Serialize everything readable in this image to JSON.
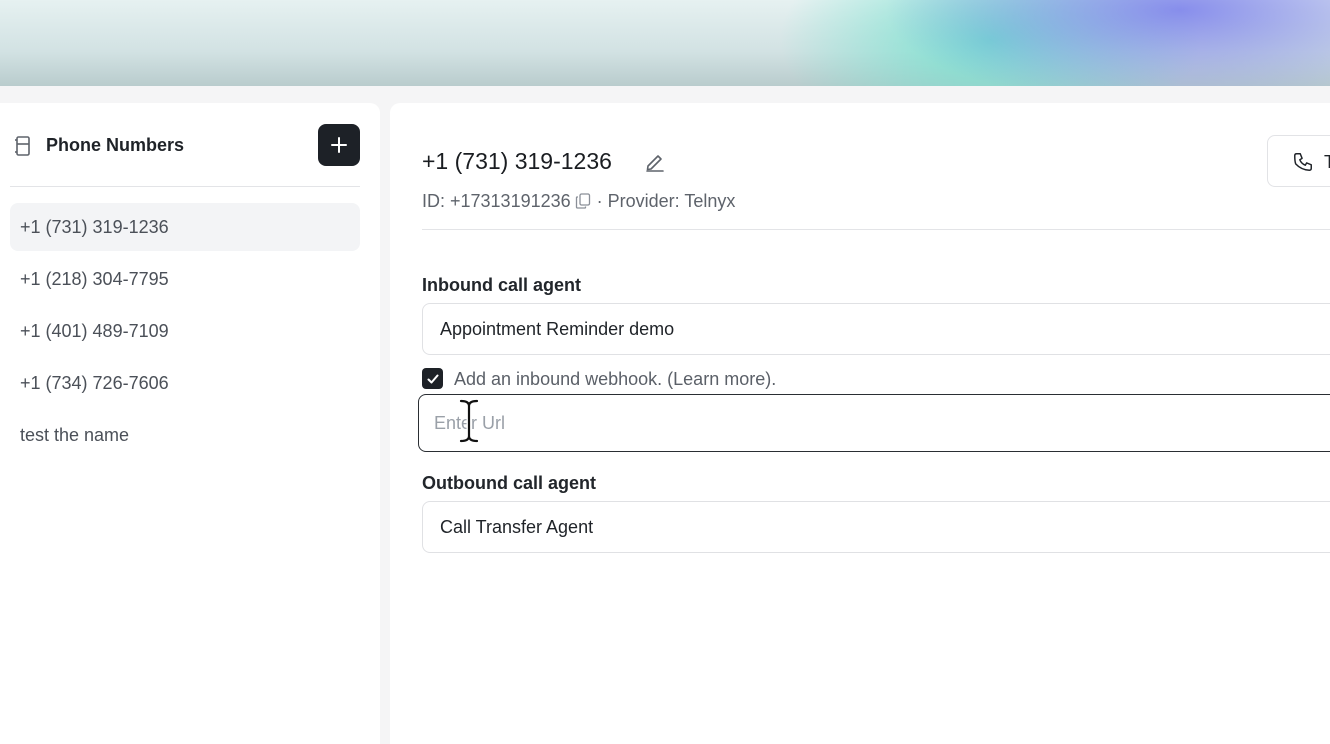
{
  "sidebar": {
    "title": "Phone Numbers",
    "items": [
      {
        "label": "+1 (731) 319-1236",
        "active": true
      },
      {
        "label": "+1 (218) 304-7795",
        "active": false
      },
      {
        "label": "+1 (401) 489-7109",
        "active": false
      },
      {
        "label": "+1 (734) 726-7606",
        "active": false
      },
      {
        "label": "test the name",
        "active": false
      }
    ]
  },
  "detail": {
    "phone_number": "+1 (731) 319-1236",
    "id_text": "ID: +17313191236",
    "provider_text": "· Provider: Telnyx",
    "call_label": "T",
    "inbound": {
      "label": "Inbound call agent",
      "value": "Appointment Reminder demo",
      "webhook_checked": true,
      "webhook_label": "Add an inbound webhook. (Learn more).",
      "webhook_placeholder": "Enter Url",
      "webhook_value": ""
    },
    "outbound": {
      "label": "Outbound call agent",
      "value": "Call Transfer Agent"
    }
  },
  "colors": {
    "primary_dark": "#1d2127",
    "active_item_bg": "#f3f4f6",
    "border": "#e0e1e4"
  },
  "icons": {
    "sidebar": "phone-book-icon",
    "add": "plus-icon",
    "edit": "pencil-icon",
    "copy": "copy-icon",
    "call": "phone-icon",
    "checkbox": "check-icon",
    "cursor": "text-cursor-icon"
  }
}
